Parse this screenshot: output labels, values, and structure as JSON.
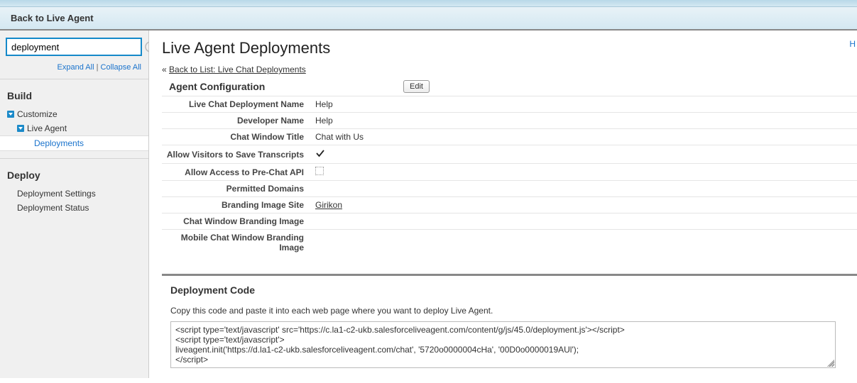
{
  "breadcrumb": {
    "back_label": "Back to Live Agent"
  },
  "sidebar": {
    "search_value": "deployment",
    "expand_label": "Expand All",
    "collapse_label": "Collapse All",
    "build_heading": "Build",
    "customize_label": "Customize",
    "live_agent_label": "Live Agent",
    "deployments_label": "Deployments",
    "deploy_heading": "Deploy",
    "deployment_settings_label": "Deployment Settings",
    "deployment_status_label": "Deployment Status"
  },
  "page": {
    "title": "Live Agent Deployments",
    "back_list_label": "Back to List: Live Chat Deployments",
    "top_right": "H"
  },
  "config": {
    "heading": "Agent Configuration",
    "edit_label": "Edit",
    "rows": {
      "deployment_name_label": "Live Chat Deployment Name",
      "deployment_name_value": "Help",
      "developer_name_label": "Developer Name",
      "developer_name_value": "Help",
      "chat_window_title_label": "Chat Window Title",
      "chat_window_title_value": "Chat with Us",
      "save_transcripts_label": "Allow Visitors to Save Transcripts",
      "prechat_api_label": "Allow Access to Pre-Chat API",
      "permitted_domains_label": "Permitted Domains",
      "branding_site_label": "Branding Image Site",
      "branding_site_value": "Girikon",
      "chat_branding_image_label": "Chat Window Branding Image",
      "mobile_branding_image_label": "Mobile Chat Window Branding Image"
    }
  },
  "deployment_code": {
    "heading": "Deployment Code",
    "description": "Copy this code and paste it into each web page where you want to deploy Live Agent.",
    "code": "<script type='text/javascript' src='https://c.la1-c2-ukb.salesforceliveagent.com/content/g/js/45.0/deployment.js'></script>\n<script type='text/javascript'>\nliveagent.init('https://d.la1-c2-ukb.salesforceliveagent.com/chat', '5720o0000004cHa', '00D0o0000019AUl');\n</script>"
  }
}
